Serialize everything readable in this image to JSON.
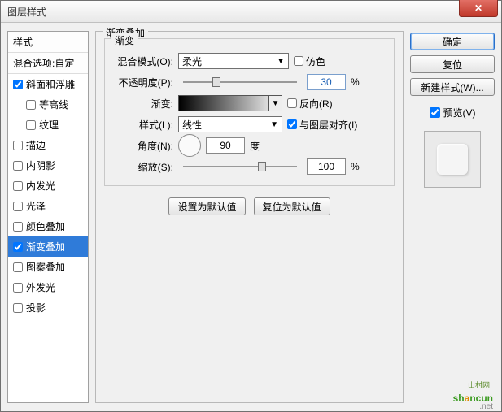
{
  "window": {
    "title": "图层样式"
  },
  "styles": {
    "header": "样式",
    "blend_opts": "混合选项:自定",
    "items": [
      {
        "label": "斜面和浮雕",
        "checked": true,
        "indent": false
      },
      {
        "label": "等高线",
        "checked": false,
        "indent": true
      },
      {
        "label": "纹理",
        "checked": false,
        "indent": true
      },
      {
        "label": "描边",
        "checked": false,
        "indent": false
      },
      {
        "label": "内阴影",
        "checked": false,
        "indent": false
      },
      {
        "label": "内发光",
        "checked": false,
        "indent": false
      },
      {
        "label": "光泽",
        "checked": false,
        "indent": false
      },
      {
        "label": "颜色叠加",
        "checked": false,
        "indent": false
      },
      {
        "label": "渐变叠加",
        "checked": true,
        "indent": false,
        "selected": true
      },
      {
        "label": "图案叠加",
        "checked": false,
        "indent": false
      },
      {
        "label": "外发光",
        "checked": false,
        "indent": false
      },
      {
        "label": "投影",
        "checked": false,
        "indent": false
      }
    ]
  },
  "panel": {
    "title": "渐变叠加",
    "group_title": "渐变",
    "blend_mode": {
      "label": "混合模式(O):",
      "value": "柔光"
    },
    "dither": {
      "label": "仿色"
    },
    "opacity": {
      "label": "不透明度(P):",
      "value": "30",
      "unit": "%"
    },
    "gradient": {
      "label": "渐变:"
    },
    "reverse": {
      "label": "反向(R)"
    },
    "style": {
      "label": "样式(L):",
      "value": "线性"
    },
    "align": {
      "label": "与图层对齐(I)"
    },
    "angle": {
      "label": "角度(N):",
      "value": "90",
      "unit": "度"
    },
    "scale": {
      "label": "缩放(S):",
      "value": "100",
      "unit": "%"
    },
    "make_default": "设置为默认值",
    "reset_default": "复位为默认值"
  },
  "buttons": {
    "ok": "确定",
    "cancel": "复位",
    "new_style": "新建样式(W)...",
    "preview": "预览(V)"
  },
  "watermark": {
    "text1": "sh",
    "text2": "a",
    "text3": "ncun",
    "cn": "山村网",
    "net": ".net"
  }
}
